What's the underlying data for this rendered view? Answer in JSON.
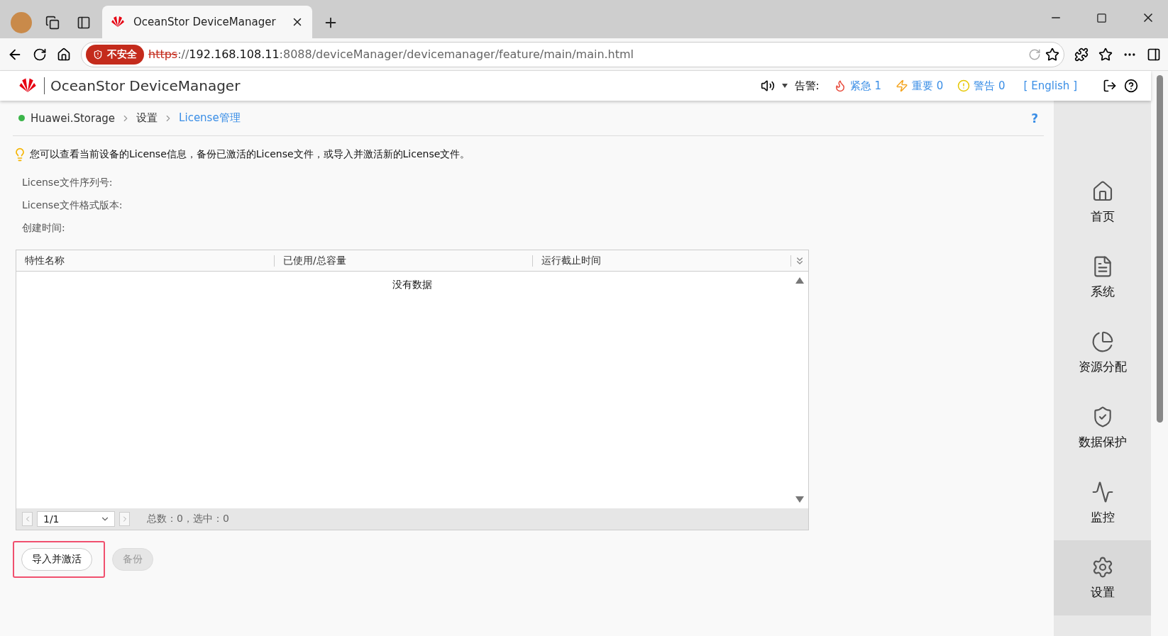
{
  "browser": {
    "tab_title": "OceanStor DeviceManager",
    "security_badge": "不安全",
    "url": {
      "scheme": "https",
      "separator": "://",
      "host": "192.168.108.11",
      "rest": ":8088/deviceManager/devicemanager/feature/main/main.html"
    }
  },
  "header": {
    "title": "OceanStor DeviceManager",
    "alarm_label": "告警:",
    "alarms": [
      {
        "kind": "critical",
        "label": "紧急 1"
      },
      {
        "kind": "major",
        "label": "重要 0"
      },
      {
        "kind": "warning",
        "label": "警告 0"
      }
    ],
    "language": "[ English ]"
  },
  "breadcrumb": [
    {
      "label": "Huawei.Storage",
      "selected": false
    },
    {
      "label": "设置",
      "selected": false
    },
    {
      "label": "License管理",
      "selected": true
    }
  ],
  "help": "?",
  "hint": "您可以查看当前设备的License信息，备份已激活的License文件，或导入并激活新的License文件。",
  "fields": [
    "License文件序列号:",
    "License文件格式版本:",
    "创建时间:"
  ],
  "table": {
    "columns": [
      "特性名称",
      "已使用/总容量",
      "运行截止时间"
    ],
    "empty_text": "没有数据",
    "page": "1/1",
    "summary": "总数：0，选中：0"
  },
  "buttons": [
    {
      "label": "导入并激活",
      "disabled": false,
      "highlighted": true
    },
    {
      "label": "备份",
      "disabled": true,
      "highlighted": false
    }
  ],
  "nav": [
    {
      "kind": "home",
      "label": "首页",
      "selected": false
    },
    {
      "kind": "system",
      "label": "系统",
      "selected": false
    },
    {
      "kind": "resource",
      "label": "资源分配",
      "selected": false
    },
    {
      "kind": "protect",
      "label": "数据保护",
      "selected": false
    },
    {
      "kind": "monitor",
      "label": "监控",
      "selected": false
    },
    {
      "kind": "settings",
      "label": "设置",
      "selected": true
    }
  ]
}
